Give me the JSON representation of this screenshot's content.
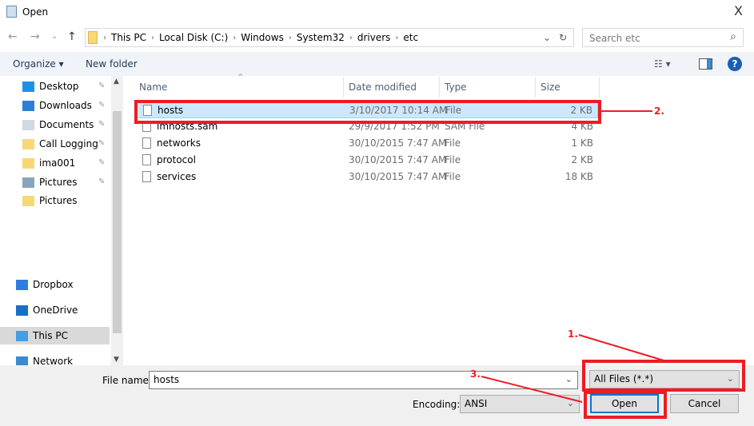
{
  "window": {
    "title": "Open",
    "close": "X"
  },
  "nav": {
    "back": "←",
    "forward": "→",
    "recent": "⌄",
    "up": "↑"
  },
  "address": {
    "crumbs": [
      "This PC",
      "Local Disk (C:)",
      "Windows",
      "System32",
      "drivers",
      "etc"
    ],
    "sep": "›",
    "dropdown": "⌄",
    "refresh": "↻"
  },
  "search": {
    "placeholder": "Search etc",
    "icon": "⌕"
  },
  "toolbar": {
    "organize": "Organize ▾",
    "new_folder": "New folder",
    "view": "☷ ▾",
    "help": "?"
  },
  "sidebar": {
    "items": [
      {
        "label": "Desktop",
        "icon": "desktop-icon",
        "color": "#1e90e8",
        "pinned": true
      },
      {
        "label": "Downloads",
        "icon": "download-icon",
        "color": "#2d7fd3",
        "pinned": true
      },
      {
        "label": "Documents",
        "icon": "documents-icon",
        "color": "#cfd8e3",
        "pinned": true
      },
      {
        "label": "Call Logging",
        "icon": "folder-icon",
        "color": "#f8d775",
        "pinned": true
      },
      {
        "label": "ima001",
        "icon": "folder-icon",
        "color": "#f8d775",
        "pinned": true
      },
      {
        "label": "Pictures",
        "icon": "pictures-icon",
        "color": "#8aa4c0",
        "pinned": true
      },
      {
        "label": "Pictures",
        "icon": "folder-icon",
        "color": "#f8d775",
        "pinned": false
      }
    ],
    "locations": [
      {
        "label": "Dropbox",
        "icon": "dropbox-icon",
        "color": "#2c7ee0"
      },
      {
        "label": "OneDrive",
        "icon": "onedrive-icon",
        "color": "#1a6fc4"
      },
      {
        "label": "This PC",
        "icon": "computer-icon",
        "color": "#3fa0e8",
        "selected": true
      },
      {
        "label": "Network",
        "icon": "network-icon",
        "color": "#3a8ad0"
      }
    ],
    "pin_glyph": "📌"
  },
  "columns": [
    "Name",
    "Date modified",
    "Type",
    "Size"
  ],
  "files": [
    {
      "name": "hosts",
      "date": "3/10/2017 10:14 AM",
      "type": "File",
      "size": "2 KB",
      "selected": true
    },
    {
      "name": "lmhosts.sam",
      "date": "29/9/2017 1:52 PM",
      "type": "SAM File",
      "size": "4 KB"
    },
    {
      "name": "networks",
      "date": "30/10/2015 7:47 AM",
      "type": "File",
      "size": "1 KB"
    },
    {
      "name": "protocol",
      "date": "30/10/2015 7:47 AM",
      "type": "File",
      "size": "2 KB"
    },
    {
      "name": "services",
      "date": "30/10/2015 7:47 AM",
      "type": "File",
      "size": "18 KB"
    }
  ],
  "footer": {
    "file_name_label": "File name:",
    "file_name_value": "hosts",
    "filter": "All Files  (*.*)",
    "encoding_label": "Encoding:",
    "encoding_value": "ANSI",
    "open": "Open",
    "cancel": "Cancel",
    "chevron": "⌄"
  },
  "annotations": {
    "one": "1.",
    "two": "2.",
    "three": "3.",
    "color": "#ed1c24"
  }
}
